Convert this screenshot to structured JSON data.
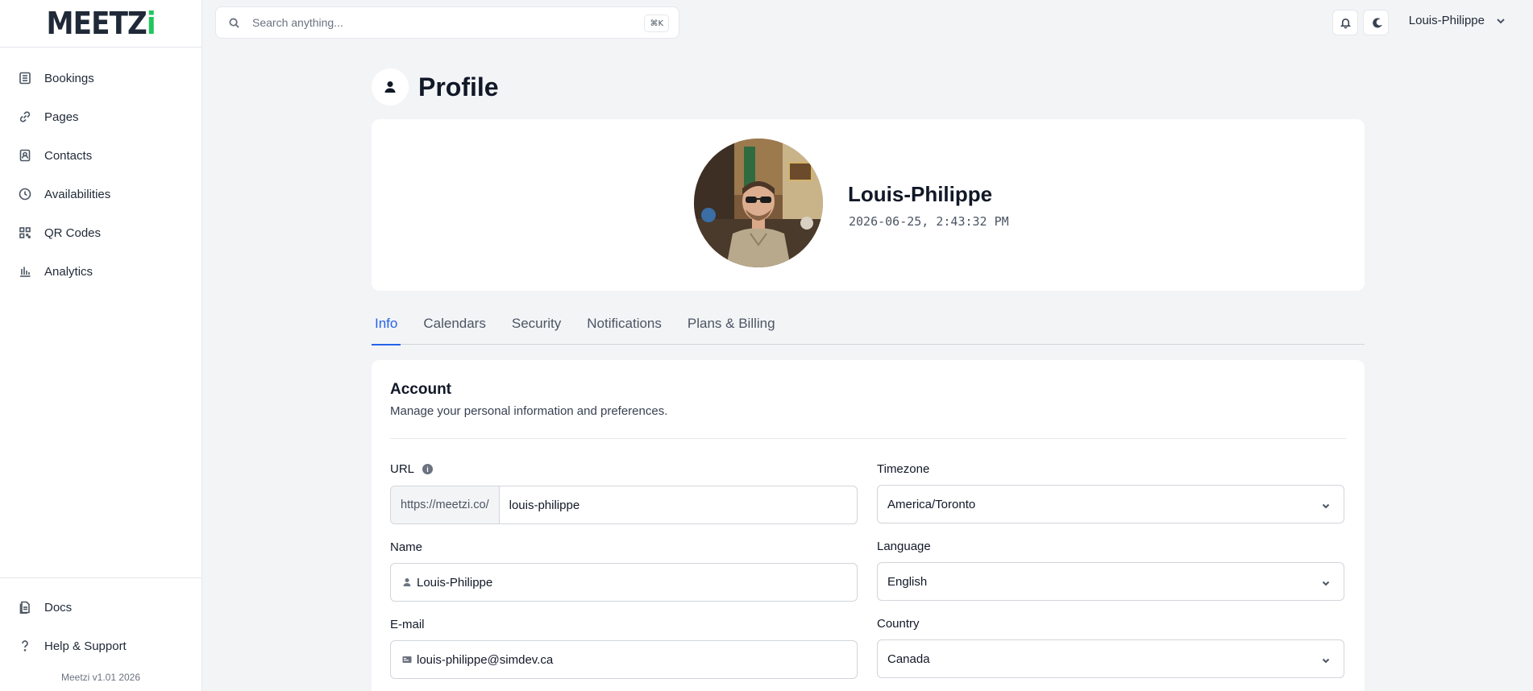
{
  "app": {
    "logo_main": "MEETZ",
    "logo_accent": "i",
    "version": "Meetzi v1.01 2026"
  },
  "sidebar": {
    "items": [
      {
        "label": "Bookings",
        "icon": "list-icon"
      },
      {
        "label": "Pages",
        "icon": "link-icon"
      },
      {
        "label": "Contacts",
        "icon": "contact-book-icon"
      },
      {
        "label": "Availabilities",
        "icon": "clock-icon"
      },
      {
        "label": "QR Codes",
        "icon": "qr-code-icon"
      },
      {
        "label": "Analytics",
        "icon": "bar-chart-icon"
      }
    ],
    "bottom_items": [
      {
        "label": "Docs",
        "icon": "document-icon"
      },
      {
        "label": "Help & Support",
        "icon": "question-icon"
      }
    ]
  },
  "topbar": {
    "search_placeholder": "Search anything...",
    "search_shortcut": "⌘K",
    "user_name": "Louis-Philippe"
  },
  "page": {
    "title": "Profile"
  },
  "profile": {
    "name": "Louis-Philippe",
    "timestamp": "2026-06-25, 2:43:32 PM"
  },
  "tabs": [
    {
      "label": "Info",
      "active": true
    },
    {
      "label": "Calendars",
      "active": false
    },
    {
      "label": "Security",
      "active": false
    },
    {
      "label": "Notifications",
      "active": false
    },
    {
      "label": "Plans & Billing",
      "active": false
    }
  ],
  "account": {
    "title": "Account",
    "description": "Manage your personal information and preferences.",
    "url": {
      "label": "URL",
      "prefix": "https://meetzi.co/",
      "value": "louis-philippe"
    },
    "name": {
      "label": "Name",
      "value": "Louis-Philippe"
    },
    "email": {
      "label": "E-mail",
      "value": "louis-philippe@simdev.ca"
    },
    "timezone": {
      "label": "Timezone",
      "value": "America/Toronto"
    },
    "language": {
      "label": "Language",
      "value": "English"
    },
    "country": {
      "label": "Country",
      "value": "Canada"
    }
  },
  "colors": {
    "accent": "#2563eb",
    "logo_accent": "#22c55e",
    "background": "#f3f4f6"
  }
}
